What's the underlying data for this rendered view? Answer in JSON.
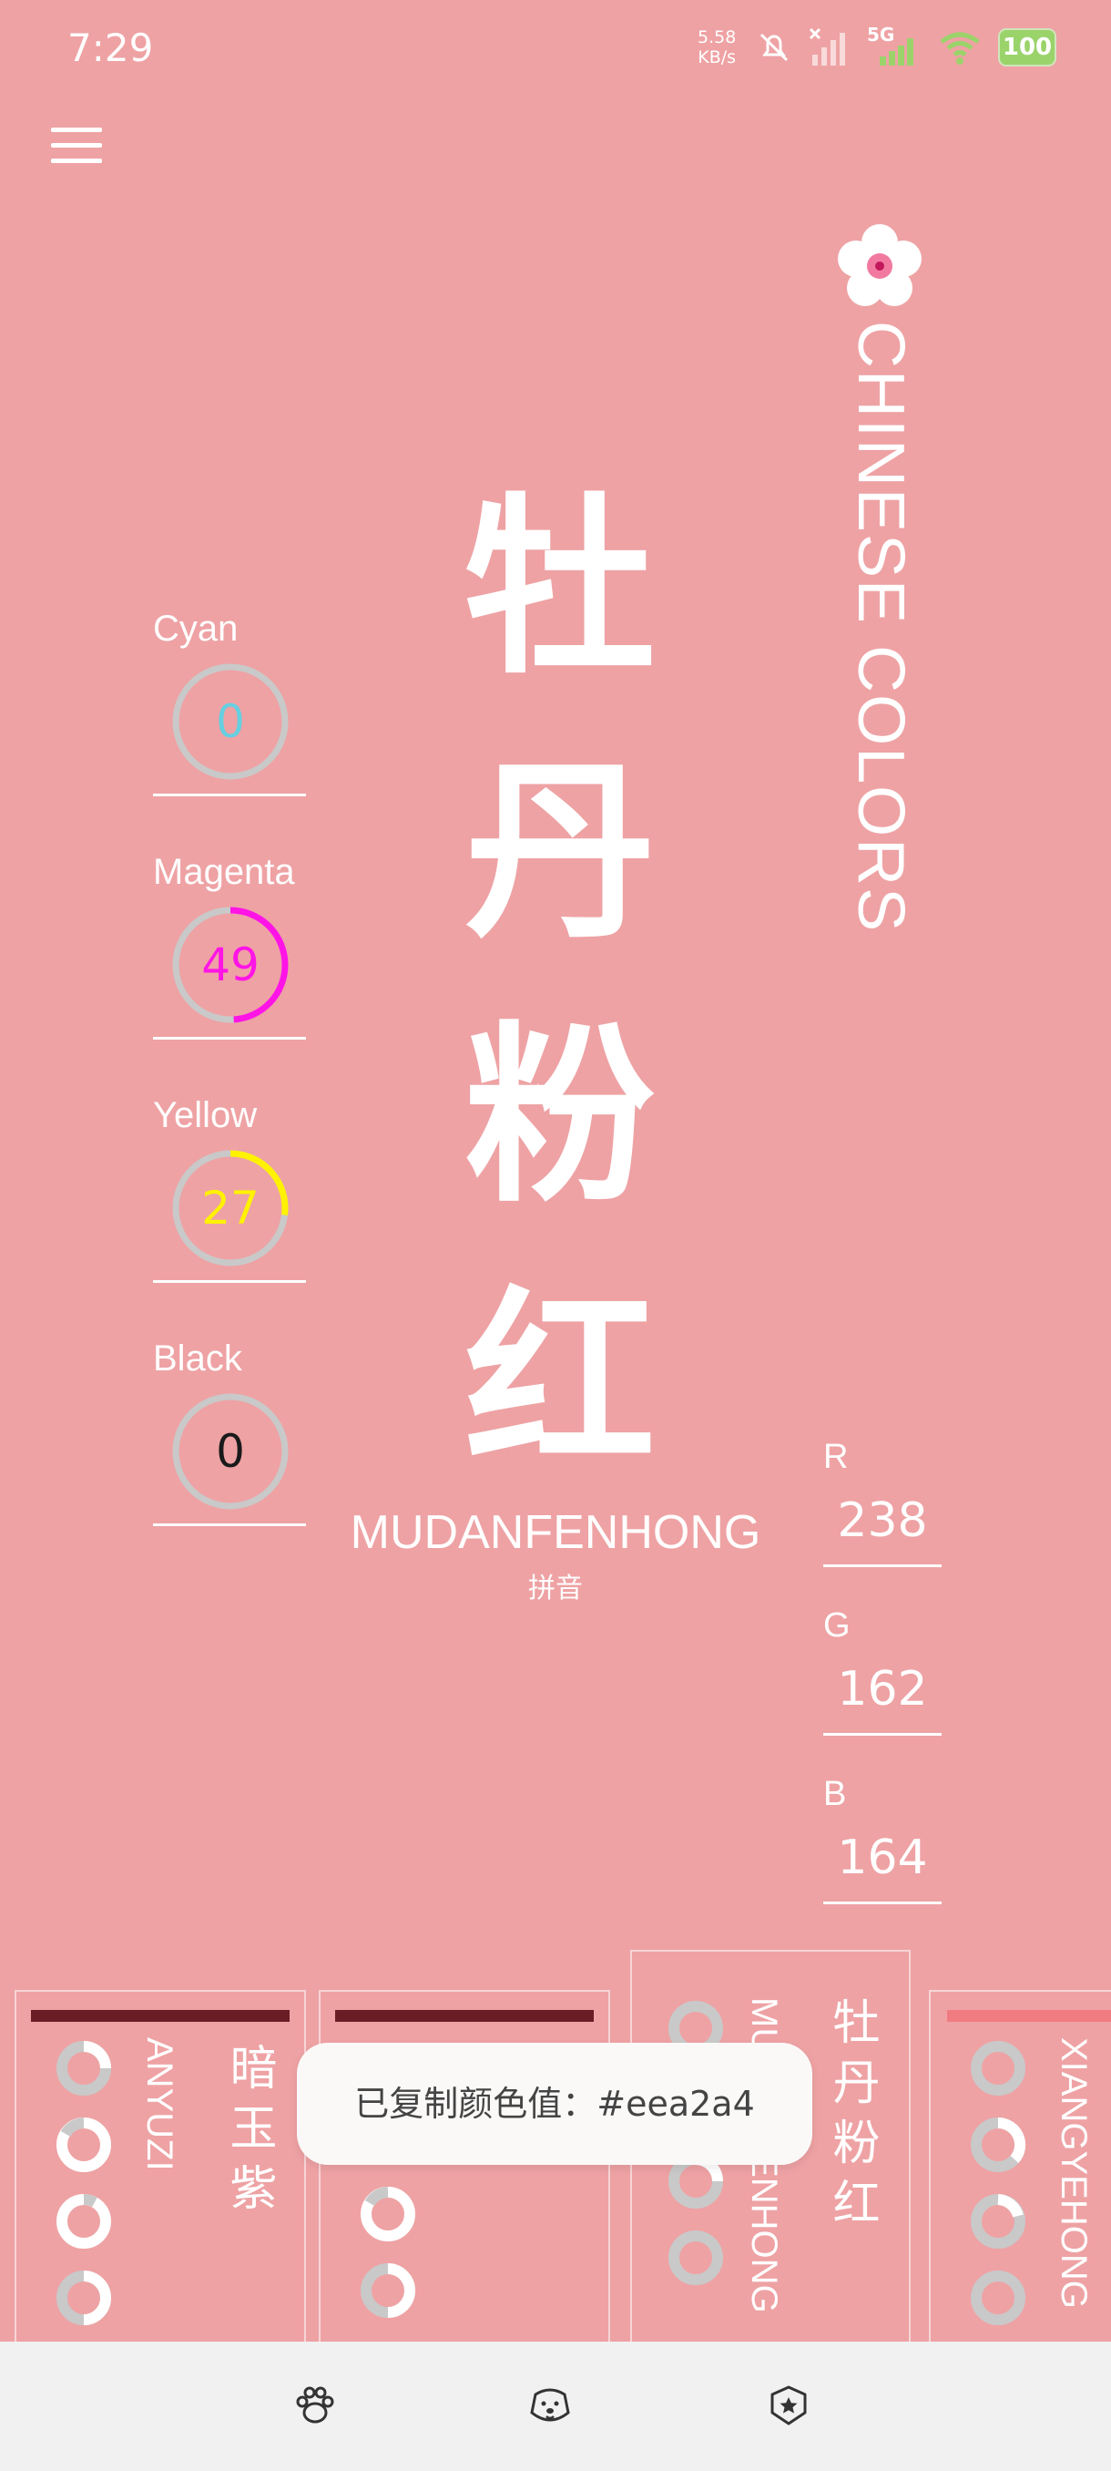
{
  "status": {
    "time": "7:29",
    "net_speed_top": "5.58",
    "net_speed_unit": "KB/s",
    "network": "5G",
    "battery": "100"
  },
  "brand": {
    "title": "CHINESE COLORS"
  },
  "color": {
    "name_chars": [
      "牡",
      "丹",
      "粉",
      "红"
    ],
    "pinyin": "MUDANFENHONG",
    "pinyin_label": "拼音",
    "hex": "#eea2a4"
  },
  "cmyk": [
    {
      "label": "Cyan",
      "value": "0",
      "fraction": 0.0,
      "color": "#66cfe0"
    },
    {
      "label": "Magenta",
      "value": "49",
      "fraction": 0.49,
      "color": "#ff14e6"
    },
    {
      "label": "Yellow",
      "value": "27",
      "fraction": 0.27,
      "color": "#fff200"
    },
    {
      "label": "Black",
      "value": "0",
      "fraction": 0.0,
      "color": "#1a1a1a"
    }
  ],
  "rgb": [
    {
      "label": "R",
      "value": "238"
    },
    {
      "label": "G",
      "value": "162"
    },
    {
      "label": "B",
      "value": "164"
    }
  ],
  "cards": [
    {
      "name": "暗玉紫",
      "pinyin": "ANYUZI",
      "bar_color": "#6b1d26"
    },
    {
      "name": "",
      "pinyin": "",
      "bar_color": "#6b1d26"
    },
    {
      "name": "牡丹粉红",
      "pinyin": "MUDANFENHONG",
      "bar_color": ""
    },
    {
      "name": "",
      "pinyin": "XIANGYEHONG",
      "bar_color": "#f07c82"
    }
  ],
  "toast": {
    "text": "已复制颜色值：#eea2a4"
  },
  "nav": {
    "items": [
      "paw-icon",
      "dog-icon",
      "star-badge-icon"
    ]
  }
}
